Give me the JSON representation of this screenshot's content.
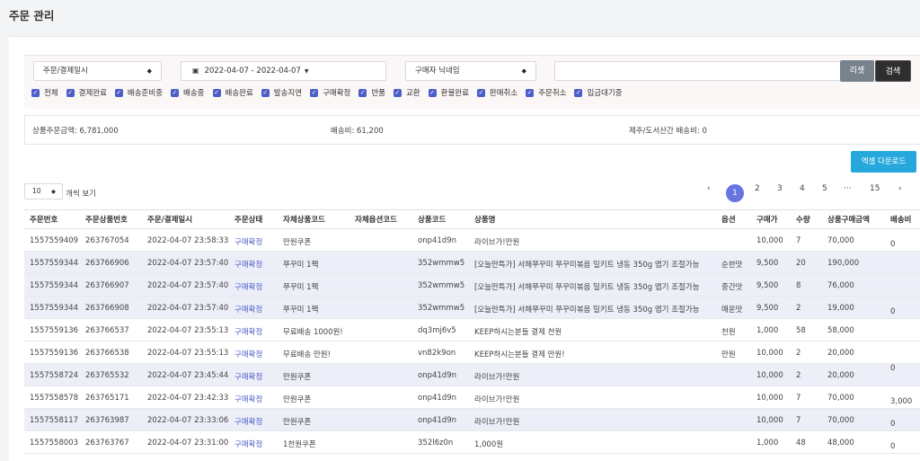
{
  "page": {
    "title": "주문 관리"
  },
  "filters": {
    "type_select": "주문/결제일시",
    "date_range": "2022-04-07 - 2022-04-07",
    "buyer_select": "구매자 닉네임",
    "search_value": "",
    "reset_label": "리셋",
    "search_label": "검색",
    "checkboxes": [
      "전체",
      "결제완료",
      "배송준비중",
      "배송중",
      "배송완료",
      "발송지연",
      "구매확정",
      "반품",
      "교환",
      "환불완료",
      "판매취소",
      "주문취소",
      "입금대기중"
    ]
  },
  "totals": {
    "order_amount": "상품주문금액: 6,781,000",
    "shipping": "배송비: 61,200",
    "jeju": "제주/도서산간 배송비: 0"
  },
  "excel_label": "엑셀 다운로드",
  "per_page": {
    "value": "10",
    "label": "개씩 보기"
  },
  "pagination": {
    "prev": "‹",
    "pages": [
      "1",
      "2",
      "3",
      "4",
      "5"
    ],
    "ellipsis": "···",
    "last": "15",
    "next": "›",
    "active": "1"
  },
  "table": {
    "headers": [
      "주문번호",
      "주문상품번호",
      "주문/결제일시",
      "주문상태",
      "자체상품코드",
      "자체옵션코드",
      "상품코드",
      "상품명",
      "옵션",
      "구매가",
      "수량",
      "상품구매금액",
      "배송비"
    ],
    "rows": [
      {
        "order": "1557559409",
        "item": "263767054",
        "date": "2022-04-07 23:58:33",
        "status": "구매확정",
        "code": "만원쿠폰",
        "opt_code": "",
        "pcode": "onp41d9n",
        "name": "라이브가!만원",
        "option": "",
        "price": "10,000",
        "qty": "7",
        "amount": "70,000"
      },
      {
        "order": "1557559344",
        "item": "263766906",
        "date": "2022-04-07 23:57:40",
        "status": "구매확정",
        "code": "쭈꾸미 1팩",
        "opt_code": "",
        "pcode": "352wmmw5",
        "name": "[오늘만특가] 서해쭈꾸미 쭈꾸미볶음 밀키트 냉동 350g 맵기 조절가능",
        "option": "순한맛",
        "price": "9,500",
        "qty": "20",
        "amount": "190,000"
      },
      {
        "order": "1557559344",
        "item": "263766907",
        "date": "2022-04-07 23:57:40",
        "status": "구매확정",
        "code": "쭈꾸미 1팩",
        "opt_code": "",
        "pcode": "352wmmw5",
        "name": "[오늘만특가] 서해쭈꾸미 쭈꾸미볶음 밀키트 냉동 350g 맵기 조절가능",
        "option": "중간맛",
        "price": "9,500",
        "qty": "8",
        "amount": "76,000"
      },
      {
        "order": "1557559344",
        "item": "263766908",
        "date": "2022-04-07 23:57:40",
        "status": "구매확정",
        "code": "쭈꾸미 1팩",
        "opt_code": "",
        "pcode": "352wmmw5",
        "name": "[오늘만특가] 서해쭈꾸미 쭈꾸미볶음 밀키트 냉동 350g 맵기 조절가능",
        "option": "매운맛",
        "price": "9,500",
        "qty": "2",
        "amount": "19,000"
      },
      {
        "order": "1557559136",
        "item": "263766537",
        "date": "2022-04-07 23:55:13",
        "status": "구매확정",
        "code": "무료배송 1000원!",
        "opt_code": "",
        "pcode": "dq3mj6v5",
        "name": "KEEP하시는분들 결제 천원",
        "option": "천원",
        "price": "1,000",
        "qty": "58",
        "amount": "58,000"
      },
      {
        "order": "1557559136",
        "item": "263766538",
        "date": "2022-04-07 23:55:13",
        "status": "구매확정",
        "code": "무료배송 만원!",
        "opt_code": "",
        "pcode": "vn82k9on",
        "name": "KEEP하시는분들 결제 만원!",
        "option": "만원",
        "price": "10,000",
        "qty": "2",
        "amount": "20,000"
      },
      {
        "order": "1557558724",
        "item": "263765532",
        "date": "2022-04-07 23:45:44",
        "status": "구매확정",
        "code": "만원쿠폰",
        "opt_code": "",
        "pcode": "onp41d9n",
        "name": "라이브가!만원",
        "option": "",
        "price": "10,000",
        "qty": "2",
        "amount": "20,000"
      },
      {
        "order": "1557558578",
        "item": "263765171",
        "date": "2022-04-07 23:42:33",
        "status": "구매확정",
        "code": "만원쿠폰",
        "opt_code": "",
        "pcode": "onp41d9n",
        "name": "라이브가!만원",
        "option": "",
        "price": "10,000",
        "qty": "7",
        "amount": "70,000"
      },
      {
        "order": "1557558117",
        "item": "263763987",
        "date": "2022-04-07 23:33:06",
        "status": "구매확정",
        "code": "만원쿠폰",
        "opt_code": "",
        "pcode": "onp41d9n",
        "name": "라이브가!만원",
        "option": "",
        "price": "10,000",
        "qty": "7",
        "amount": "70,000"
      },
      {
        "order": "1557558003",
        "item": "263763767",
        "date": "2022-04-07 23:31:00",
        "status": "구매확정",
        "code": "1천원쿠폰",
        "opt_code": "",
        "pcode": "352l6z0n",
        "name": "1,000원",
        "option": "",
        "price": "1,000",
        "qty": "48",
        "amount": "48,000"
      }
    ],
    "shipping_cells": [
      "0",
      "0",
      "0",
      "3,000",
      "0",
      "0",
      "0"
    ]
  },
  "colors": {
    "accent": "#4c5ec9",
    "excel": "#27a8dd",
    "highlight_row": "#eceef8"
  }
}
